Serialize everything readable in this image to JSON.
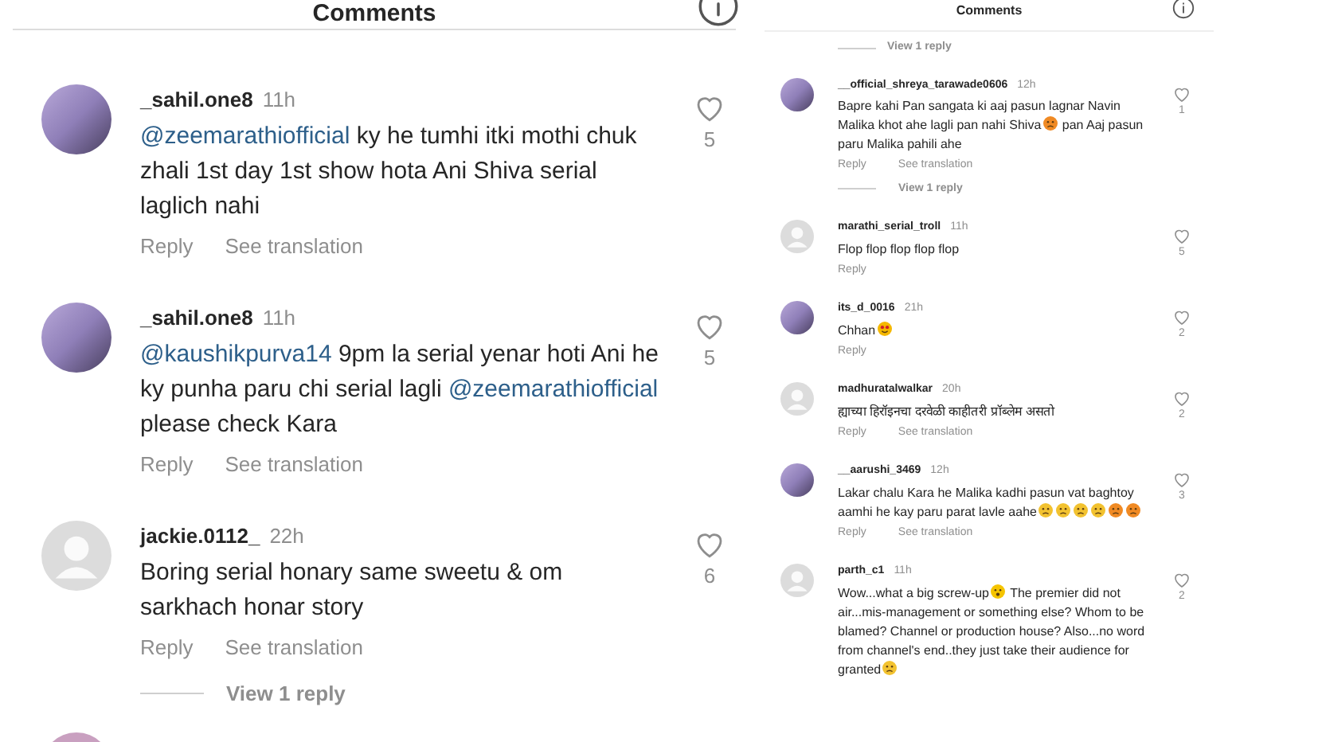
{
  "left": {
    "title": "Comments",
    "comments": [
      {
        "user": "_sahil.one8",
        "time": "11h",
        "mention": "@zeemarathiofficial",
        "text": "ky he tumhi itki mothi chuk zhali 1st day 1st show hota Ani Shiva serial laglich nahi",
        "likes": "5",
        "kind": "photo",
        "actions": [
          "Reply",
          "See translation"
        ]
      },
      {
        "user": "_sahil.one8",
        "time": "11h",
        "mention": "@kaushikpurva14",
        "text": " 9pm la serial yenar hoti Ani he ky punha paru chi serial lagli",
        "mention2": "@zeemarathiofficial",
        "text2": "please check Kara",
        "likes": "5",
        "kind": "photo",
        "actions": [
          "Reply",
          "See translation"
        ]
      },
      {
        "user": "jackie.0112_",
        "time": "22h",
        "text": "Boring serial honary same sweetu & om sarkhach honar story",
        "likes": "6",
        "kind": "default",
        "actions": [
          "Reply",
          "See translation"
        ],
        "view_replies": "View 1 reply"
      }
    ]
  },
  "right": {
    "title": "Comments",
    "top_view_replies": "View 1 reply",
    "comments": [
      {
        "user": "__official_shreya_tarawade0606",
        "time": "12h",
        "text": "Bapre kahi Pan sangata ki aaj pasun lagnar Navin Malika khot ahe lagli pan nahi  Shiva",
        "emojis": [
          {
            "kind": "angry"
          }
        ],
        "text2": "pan Aaj pasun paru Malika pahili ahe",
        "likes": "1",
        "kind": "photo",
        "actions": [
          "Reply",
          "See translation"
        ],
        "view_replies": "View 1 reply"
      },
      {
        "user": "marathi_serial_troll",
        "time": "11h",
        "text": "Flop flop flop flop flop",
        "likes": "5",
        "kind": "default",
        "actions": [
          "Reply"
        ]
      },
      {
        "user": "its_d_0016",
        "time": "21h",
        "text": "Chhan",
        "emojis": [
          {
            "kind": "love"
          }
        ],
        "likes": "2",
        "kind": "photo",
        "actions": [
          "Reply"
        ]
      },
      {
        "user": "madhuratalwalkar",
        "time": "20h",
        "text": "ह्याच्या हिरॉइनचा दरवेळी काहीतरी प्रॉब्लेम असतो",
        "likes": "2",
        "kind": "default",
        "actions": [
          "Reply",
          "See translation"
        ]
      },
      {
        "user": "__aarushi_3469",
        "time": "12h",
        "text": "Lakar chalu Kara he Malika kadhi pasun vat baghtoy aamhi he kay paru parat lavle aahe",
        "emojis": [
          {
            "kind": "sad"
          },
          {
            "kind": "sad"
          },
          {
            "kind": "sad"
          },
          {
            "kind": "sad"
          },
          {
            "kind": "angry"
          },
          {
            "kind": "angry"
          }
        ],
        "likes": "3",
        "kind": "photo",
        "actions": [
          "Reply",
          "See translation"
        ]
      },
      {
        "user": "parth_c1",
        "time": "11h",
        "text": "Wow...what a big screw-up",
        "emojis": [
          {
            "kind": "shock"
          }
        ],
        "text2": "The premier did not air...mis-management or something else? Whom to be blamed? Channel or production house? Also...no word from channel's end..they just take their audience for granted",
        "emojis2": [
          {
            "kind": "sad"
          }
        ],
        "likes": "2",
        "kind": "default"
      }
    ]
  }
}
